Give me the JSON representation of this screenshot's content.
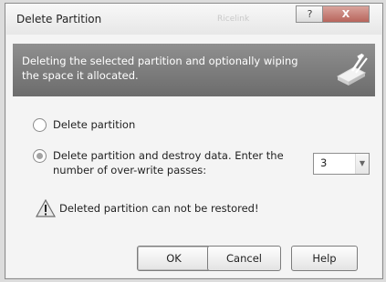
{
  "window": {
    "title": "Delete Partition",
    "ghost_text": "Ricelink",
    "help_button": "?",
    "close_button": "X"
  },
  "banner": {
    "description": "Deleting the selected partition and optionally wiping the space it allocated.",
    "icon": "eraser-wipe-icon"
  },
  "options": {
    "delete_only": {
      "label": "Delete partition",
      "selected": false
    },
    "delete_destroy": {
      "label_line1": "Delete partition and destroy data. Enter the",
      "label_line2": "number of over-write passes:",
      "selected": true
    }
  },
  "passes": {
    "value": "3"
  },
  "warning": {
    "icon": "warning-triangle-icon",
    "text": "Deleted partition can not be restored!"
  },
  "buttons": {
    "ok": "OK",
    "cancel": "Cancel",
    "help": "Help"
  }
}
